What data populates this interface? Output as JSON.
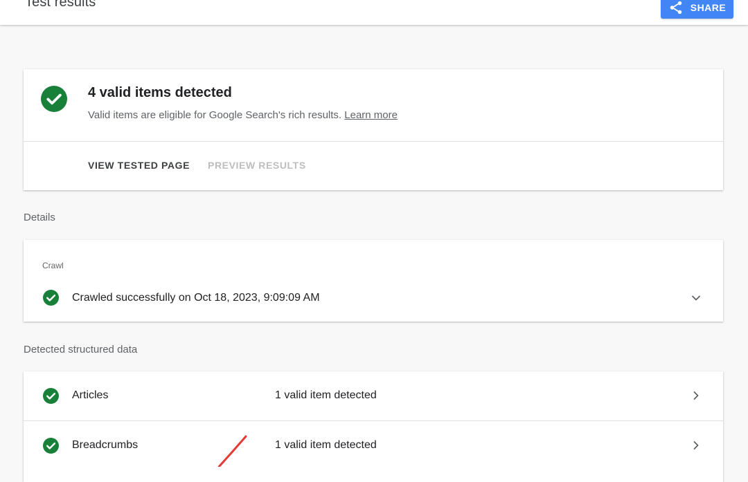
{
  "header": {
    "title": "Test results",
    "share_label": "SHARE"
  },
  "summary": {
    "title": "4 valid items detected",
    "description": "Valid items are eligible for Google Search's rich results.",
    "learn_more": "Learn more",
    "actions": {
      "view_tested_page": "VIEW TESTED PAGE",
      "preview_results": "PREVIEW RESULTS"
    }
  },
  "details": {
    "section_label": "Details",
    "crawl": {
      "heading": "Crawl",
      "status": "Crawled successfully on Oct 18, 2023, 9:09:09 AM"
    }
  },
  "structured_data": {
    "section_label": "Detected structured data",
    "items": [
      {
        "name": "Articles",
        "status": "1 valid item detected"
      },
      {
        "name": "Breadcrumbs",
        "status": "1 valid item detected"
      }
    ]
  },
  "icons": {
    "status": "check-circle-icon",
    "share": "share-icon",
    "expand": "chevron-down-icon",
    "open": "chevron-right-icon"
  },
  "colors": {
    "valid_green": "#188038",
    "share_blue": "#4285f4",
    "disabled_text": "#bdbdbd",
    "annotation_red": "#e53935"
  }
}
